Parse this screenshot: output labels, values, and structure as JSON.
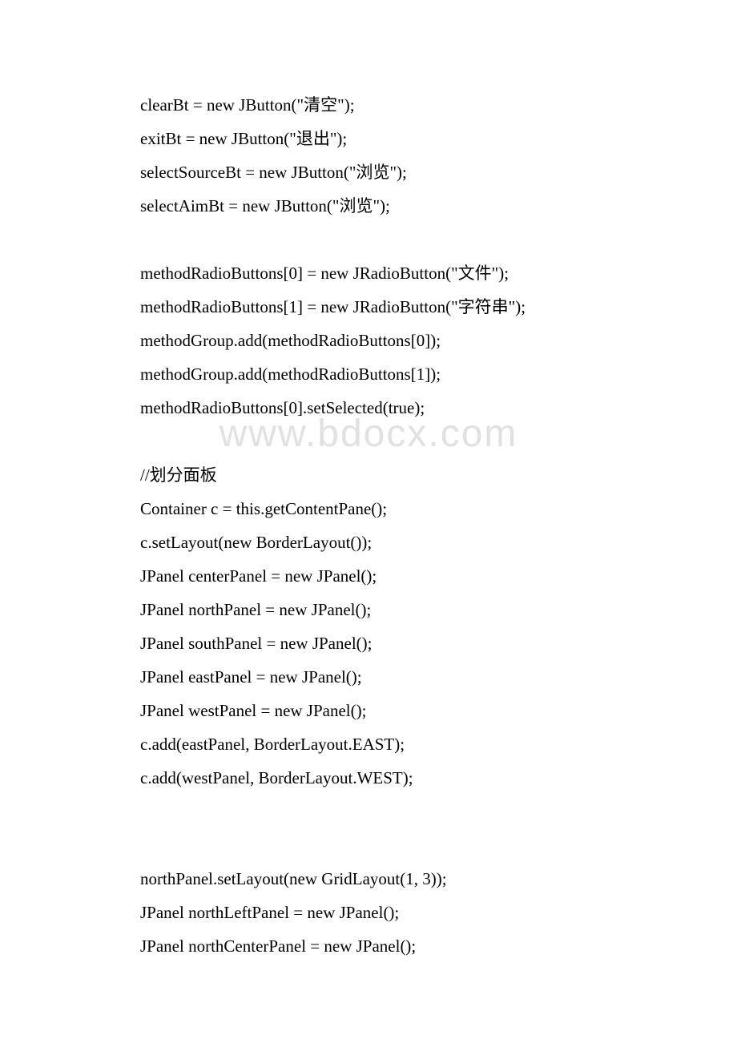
{
  "watermark": "www.bdocx.com",
  "lines": [
    "clearBt = new JButton(\"清空\");",
    "exitBt = new JButton(\"退出\");",
    "selectSourceBt = new JButton(\"浏览\");",
    "selectAimBt = new JButton(\"浏览\");",
    "",
    "methodRadioButtons[0] = new JRadioButton(\"文件\");",
    "methodRadioButtons[1] = new JRadioButton(\"字符串\");",
    "methodGroup.add(methodRadioButtons[0]);",
    "methodGroup.add(methodRadioButtons[1]);",
    "methodRadioButtons[0].setSelected(true);",
    "",
    "//划分面板",
    "Container c = this.getContentPane();",
    "c.setLayout(new BorderLayout());",
    "JPanel centerPanel = new JPanel();",
    "JPanel northPanel = new JPanel();",
    "JPanel southPanel = new JPanel();",
    "JPanel eastPanel = new JPanel();",
    "JPanel westPanel = new JPanel();",
    "c.add(eastPanel, BorderLayout.EAST);",
    "c.add(westPanel, BorderLayout.WEST);",
    "",
    "",
    "northPanel.setLayout(new GridLayout(1, 3));",
    "JPanel northLeftPanel = new JPanel();",
    "JPanel northCenterPanel = new JPanel();"
  ]
}
